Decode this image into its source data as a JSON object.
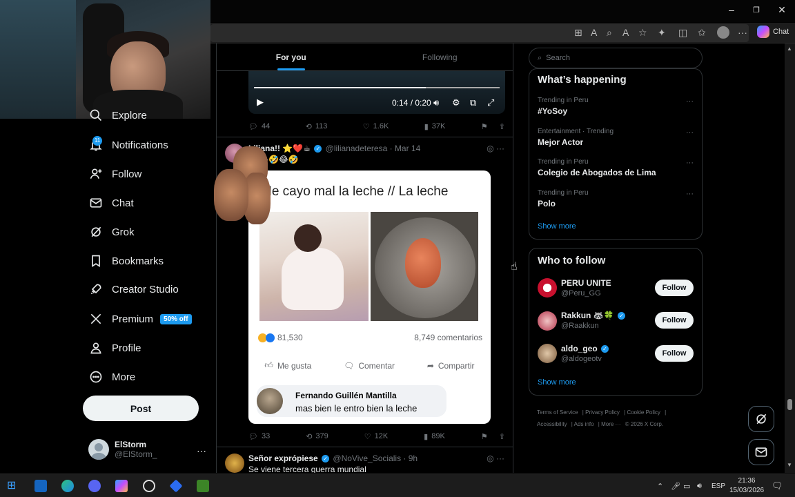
{
  "browser": {
    "window_controls": {
      "minimize": "–",
      "maximize": "❐",
      "close": "✕"
    },
    "copilot_label": "Chat"
  },
  "nav": {
    "items": [
      {
        "label": "Explore",
        "icon": "search-icon"
      },
      {
        "label": "Notifications",
        "icon": "bell-icon",
        "badge": "11"
      },
      {
        "label": "Follow",
        "icon": "person-add-icon"
      },
      {
        "label": "Chat",
        "icon": "mail-icon"
      },
      {
        "label": "Grok",
        "icon": "grok-icon"
      },
      {
        "label": "Bookmarks",
        "icon": "bookmark-icon"
      },
      {
        "label": "Creator Studio",
        "icon": "rocket-icon"
      },
      {
        "label": "Premium",
        "icon": "x-logo-icon",
        "badge": "50% off"
      },
      {
        "label": "Profile",
        "icon": "person-icon"
      },
      {
        "label": "More",
        "icon": "more-circle-icon"
      }
    ],
    "post_button": "Post",
    "account": {
      "name": "ElStorm",
      "handle": "@ElStorm_",
      "more": "···"
    }
  },
  "feed": {
    "tabs": [
      {
        "label": "For you",
        "active": true
      },
      {
        "label": "Following",
        "active": false
      }
    ],
    "video": {
      "time": "0:14 / 0:20",
      "progress": 0.7
    },
    "post1_stats": {
      "replies": "44",
      "reposts": "113",
      "likes": "1.6K",
      "views": "37K"
    },
    "post2": {
      "author": "Liliana!! ⭐❤️☕",
      "handle": "@lilianadeteresa",
      "date": "· Mar 14",
      "text": "🤣😂🤣😂🤣",
      "card": {
        "title": "Me cayo mal la leche // La leche",
        "reactions": "81,530",
        "comments": "8,749 comentarios",
        "like_label": "Me gusta",
        "comment_label": "Comentar",
        "share_label": "Compartir",
        "comment_author": "Fernando Guillén Mantilla",
        "comment_text": "mas bien le entro bien la leche"
      },
      "stats": {
        "replies": "33",
        "reposts": "379",
        "likes": "12K",
        "views": "89K"
      }
    },
    "post3": {
      "author": "Señor exprópiese",
      "handle": "@NoVive_Socialis",
      "date": "· 9h",
      "text": "Se viene tercera guerra mundial"
    }
  },
  "sidebar": {
    "search_placeholder": "Search",
    "happening": {
      "title": "What’s happening",
      "trends": [
        {
          "meta": "Trending in Peru",
          "name": "#YoSoy"
        },
        {
          "meta": "Entertainment · Trending",
          "name": "Mejor Actor"
        },
        {
          "meta": "Trending in Peru",
          "name": "Colegio de Abogados de Lima"
        },
        {
          "meta": "Trending in Peru",
          "name": "Polo"
        }
      ],
      "show_more": "Show more"
    },
    "who_to_follow": {
      "title": "Who to follow",
      "accounts": [
        {
          "name": "PERU UNITE",
          "handle": "@Peru_GG",
          "button": "Follow"
        },
        {
          "name": "Rakkun 🦝🍀",
          "handle": "@Raakkun",
          "button": "Follow"
        },
        {
          "name": "aldo_geo",
          "handle": "@aldogeotv",
          "button": "Follow"
        }
      ],
      "show_more": "Show more"
    },
    "footer": {
      "terms": "Terms of Service",
      "privacy": "Privacy Policy",
      "cookie": "Cookie Policy",
      "accessibility": "Accessibility",
      "ads": "Ads info",
      "more": "More ···",
      "copyright": "© 2026 X Corp."
    }
  },
  "taskbar": {
    "lang": "ESP",
    "time": "21:36",
    "date": "15/03/2026"
  }
}
